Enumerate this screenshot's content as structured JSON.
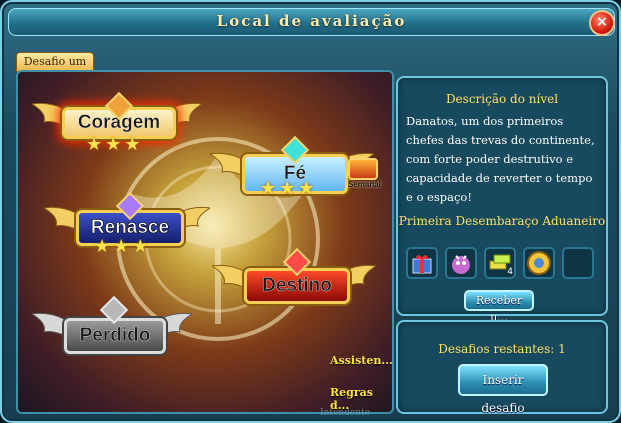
{
  "window": {
    "title": "Local de avaliação",
    "close_symbol": "×"
  },
  "tab": {
    "label": "Desafio um"
  },
  "stages": [
    {
      "name": "Coragem",
      "stars": "★★★",
      "gem_color": "#f0a23a",
      "plate_color": "#f2d08a",
      "selected": true
    },
    {
      "name": "Fé",
      "stars": "★★★",
      "gem_color": "#3fe1d8",
      "plate_color": "#8fd8ff",
      "selected": false
    },
    {
      "name": "Renasce",
      "stars": "★★★",
      "gem_color": "#a87bff",
      "plate_color": "#24318a",
      "selected": false
    },
    {
      "name": "Destino",
      "stars": "",
      "gem_color": "#ff4a4a",
      "plate_color": "#c2160c",
      "selected": false
    },
    {
      "name": "Perdido",
      "stars": "",
      "gem_color": "#b8b8b8",
      "plate_color": "#6a6a6a",
      "selected": false
    }
  ],
  "weekly": {
    "label": "Semanal"
  },
  "links": {
    "assistant": "Assisten...",
    "rules": "Regras d..."
  },
  "footer_faint": "Intendente",
  "description": {
    "header": "Descrição do nível",
    "text": "Danatos, um dos primeiros chefes das trevas do continente, com forte poder destrutivo e capacidade de reverter o tempo e o espaço!"
  },
  "first_clear": {
    "header": "Primeira Desembaraço Aduaneiro",
    "rewards": [
      {
        "icon": "gift-box-icon",
        "count": ""
      },
      {
        "icon": "pink-creature-icon",
        "count": ""
      },
      {
        "icon": "gold-bars-icon",
        "count": "4"
      },
      {
        "icon": "gear-medal-icon",
        "count": ""
      },
      {
        "icon": "empty-slot",
        "count": ""
      }
    ],
    "receive_label": "Receber u..."
  },
  "remaining": {
    "label": "Desafios restantes: 1",
    "button": "Inserir desafio"
  }
}
